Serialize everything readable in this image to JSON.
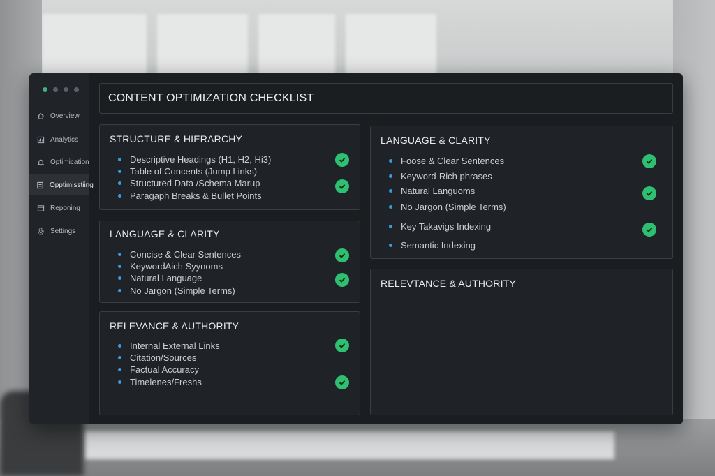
{
  "window": {
    "dot_colors": [
      "#3fb27f",
      "#5a6066",
      "#5a6066",
      "#5a6066"
    ]
  },
  "sidebar": {
    "items": [
      {
        "label": "Overview",
        "icon": "home-icon",
        "active": true
      },
      {
        "label": "Analytics",
        "icon": "chart-icon",
        "active": false
      },
      {
        "label": "Optimication",
        "icon": "bell-icon",
        "active": false
      },
      {
        "label": "Opptimisstiing",
        "icon": "document-icon",
        "active": true
      },
      {
        "label": "Reponing",
        "icon": "report-icon",
        "active": false
      },
      {
        "label": "Settings",
        "icon": "gear-icon",
        "active": false
      }
    ]
  },
  "header": {
    "title": "CONTENT OPTIMIZATION CHECKLIST"
  },
  "cards": [
    {
      "title": "STRUCTURE & HIERARCHY",
      "items": [
        {
          "text": "Descriptive Headings (H1, H2, Hi3)",
          "checked": true
        },
        {
          "text": "Table of Concents (Jump Links)",
          "checked": false
        },
        {
          "text": "Structured Data /Schema Marup",
          "checked": true
        },
        {
          "text": "Paragaph Breaks & Bullet Points",
          "checked": false
        }
      ]
    },
    {
      "title": "LANGUAGE & CLARITY",
      "items": [
        {
          "text": "Concise & Clear Sentences",
          "checked": true
        },
        {
          "text": "KeywordAich Syynoms",
          "checked": false
        },
        {
          "text": "Natural Language",
          "checked": true
        },
        {
          "text": "No Jargon (Simple Terms)",
          "checked": false
        }
      ]
    },
    {
      "title": "RELEVANCE & AUTHORITY",
      "items": [
        {
          "text": "Internal External Links",
          "checked": true
        },
        {
          "text": "Citation/Sources",
          "checked": false
        },
        {
          "text": "Factual Accuracy",
          "checked": false
        },
        {
          "text": "Timelenes/Freshs",
          "checked": true
        }
      ]
    },
    {
      "title": "LANGUAGE & CLARITY",
      "items": [
        {
          "text": "Foose & Clear Sentences",
          "checked": true
        },
        {
          "text": "Keyword-Rich phrases",
          "checked": false
        },
        {
          "text": "Natural Languoms",
          "checked": true
        },
        {
          "text": "No Jargon (Simple Terms)",
          "checked": false
        },
        {
          "text": "Key Takavigs Indexing",
          "checked": true
        },
        {
          "text": "Semantic Indexing",
          "checked": false
        }
      ]
    },
    {
      "title": "RELEVTANCE & AUTHORITY",
      "items": []
    }
  ],
  "colors": {
    "accent_check": "#2fbf71",
    "bullet": "#3a9bdc"
  }
}
